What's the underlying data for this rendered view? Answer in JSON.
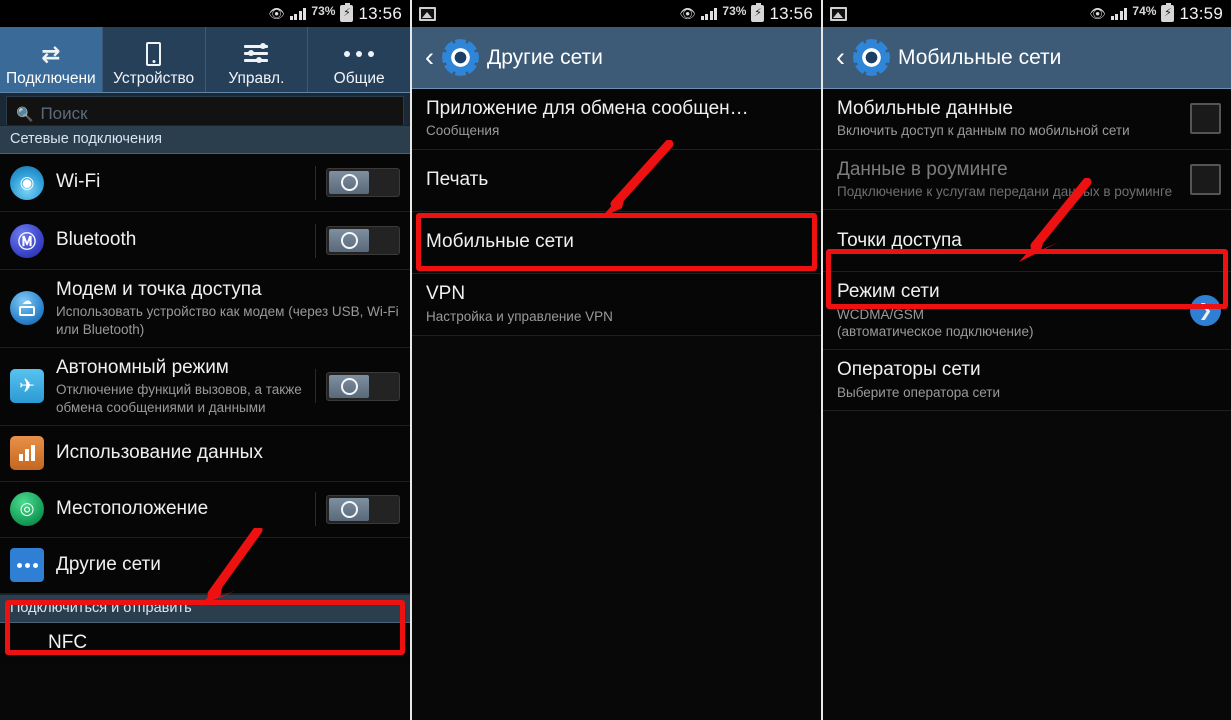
{
  "panels": [
    {
      "id": "connections",
      "status": {
        "left_icon": "image-icon",
        "eye": "eye-icon",
        "signal": "signal-icon",
        "battery_pct": "73%",
        "battery_icon": "battery-charging-icon",
        "clock": "13:56"
      },
      "tabs": [
        {
          "label": "Подключени",
          "icon": "swap-arrows-icon",
          "active": true
        },
        {
          "label": "Устройство",
          "icon": "phone-icon",
          "active": false
        },
        {
          "label": "Управл.",
          "icon": "sliders-icon",
          "active": false
        },
        {
          "label": "Общие",
          "icon": "more-dots-icon",
          "active": false
        }
      ],
      "search": {
        "placeholder": "Поиск",
        "icon": "search-icon"
      },
      "section_header": "Сетевые подключения",
      "rows": [
        {
          "icon": "wifi-icon",
          "title": "Wi-Fi",
          "sub": "",
          "control": "toggle",
          "toggle_on": false
        },
        {
          "icon": "bluetooth-icon",
          "title": "Bluetooth",
          "sub": "",
          "control": "toggle",
          "toggle_on": false
        },
        {
          "icon": "tethering-icon",
          "title": "Модем и точка доступа",
          "sub": "Использовать устройство как модем (через USB, Wi-Fi или Bluetooth)",
          "control": "none"
        },
        {
          "icon": "airplane-icon",
          "title": "Автономный режим",
          "sub": "Отключение функций вызовов, а также обмена сообщениями и данными",
          "control": "toggle",
          "toggle_on": false
        },
        {
          "icon": "data-usage-icon",
          "title": "Использование данных",
          "sub": "",
          "control": "none"
        },
        {
          "icon": "location-icon",
          "title": "Местоположение",
          "sub": "",
          "control": "toggle",
          "toggle_on": false
        },
        {
          "icon": "more-networks-icon",
          "title": "Другие сети",
          "sub": "",
          "control": "none",
          "highlighted": true
        }
      ],
      "section_header_2": "Подключиться и отправить",
      "rows_2": [
        {
          "icon": "none",
          "title": "NFC",
          "sub": "",
          "control": "none"
        }
      ]
    },
    {
      "id": "other-networks",
      "status": {
        "left_icon": "image-icon",
        "eye": "eye-icon",
        "signal": "signal-icon",
        "battery_pct": "73%",
        "battery_icon": "battery-charging-icon",
        "clock": "13:56"
      },
      "actionbar": {
        "back": "back-chevron-icon",
        "app_icon": "settings-gear-icon",
        "title": "Другие сети"
      },
      "rows": [
        {
          "title": "Приложение для обмена сообщен…",
          "sub": "Сообщения",
          "control": "none"
        },
        {
          "title": "Печать",
          "sub": "",
          "control": "none"
        },
        {
          "title": "Мобильные сети",
          "sub": "",
          "control": "none",
          "highlighted": true
        },
        {
          "title": "VPN",
          "sub": "Настройка и управление VPN",
          "control": "none"
        }
      ]
    },
    {
      "id": "mobile-networks",
      "status": {
        "left_icon": "image-icon",
        "eye": "eye-icon",
        "signal": "signal-icon",
        "battery_pct": "74%",
        "battery_icon": "battery-charging-icon",
        "clock": "13:59"
      },
      "actionbar": {
        "back": "back-chevron-icon",
        "app_icon": "settings-gear-icon",
        "title": "Мобильные сети"
      },
      "rows": [
        {
          "title": "Мобильные данные",
          "sub": "Включить доступ к данным по мобильной сети",
          "control": "checkbox",
          "checked": false,
          "dim": false
        },
        {
          "title": "Данные в роуминге",
          "sub": "Подключение к услугам передани данных в роуминге",
          "control": "checkbox",
          "checked": false,
          "dim": true
        },
        {
          "title": "Точки доступа",
          "sub": "",
          "control": "none",
          "highlighted": true
        },
        {
          "title": "Режим сети",
          "sub": "WCDMA/GSM\n(автоматическое подключение)",
          "control": "chevron"
        },
        {
          "title": "Операторы сети",
          "sub": "Выберите оператора сети",
          "control": "none"
        }
      ]
    }
  ],
  "annotations": {
    "highlight_color": "#ee1111",
    "arrows": [
      {
        "panel": "connections",
        "target": "Другие сети"
      },
      {
        "panel": "other-networks",
        "target": "Мобильные сети"
      },
      {
        "panel": "mobile-networks",
        "target": "Точки доступа"
      }
    ]
  }
}
